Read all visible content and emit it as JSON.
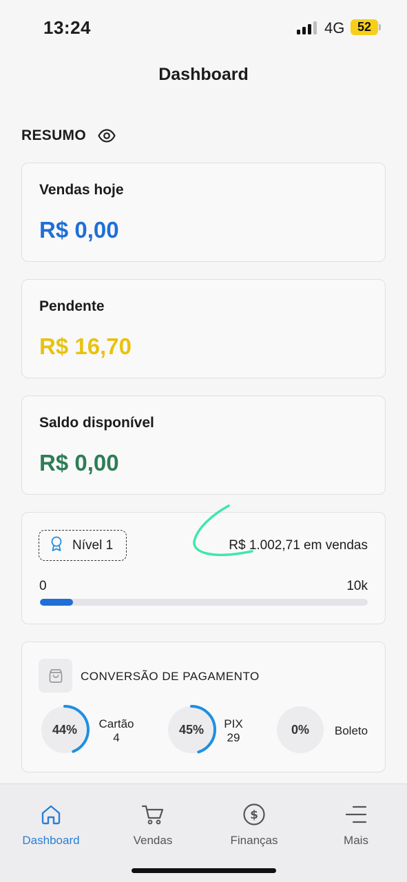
{
  "status_bar": {
    "time": "13:24",
    "network": "4G",
    "battery": "52"
  },
  "page": {
    "title": "Dashboard"
  },
  "summary": {
    "title": "RESUMO",
    "eye_icon": "eye-icon",
    "cards": [
      {
        "label": "Vendas hoje",
        "value": "R$ 0,00",
        "color": "#1f6fd6"
      },
      {
        "label": "Pendente",
        "value": "R$ 16,70",
        "color": "#e9c20f"
      },
      {
        "label": "Saldo disponível",
        "value": "R$ 0,00",
        "color": "#2e7d57"
      }
    ]
  },
  "level": {
    "badge_label": "Nível 1",
    "badge_icon": "award-ribbon-icon",
    "sales_text": "R$ 1.002,71 em vendas",
    "range_min": "0",
    "range_max": "10k",
    "progress_fraction": 0.1
  },
  "conversion": {
    "title": "CONVERSÃO DE PAGAMENTO",
    "icon": "shopping-bag-icon",
    "methods": [
      {
        "percent_label": "44%",
        "percent": 44,
        "name": "Cartão",
        "count": "4"
      },
      {
        "percent_label": "45%",
        "percent": 45,
        "name": "PIX",
        "count": "29"
      },
      {
        "percent_label": "0%",
        "percent": 0,
        "name": "Boleto",
        "count": ""
      }
    ],
    "accent_color": "#1f8fe0"
  },
  "nav": {
    "items": [
      {
        "label": "Dashboard",
        "icon": "home-icon",
        "active": true
      },
      {
        "label": "Vendas",
        "icon": "cart-icon",
        "active": false
      },
      {
        "label": "Finanças",
        "icon": "dollar-circle-icon",
        "active": false
      },
      {
        "label": "Mais",
        "icon": "menu-icon",
        "active": false
      }
    ],
    "active_color": "#2a7fd4"
  }
}
